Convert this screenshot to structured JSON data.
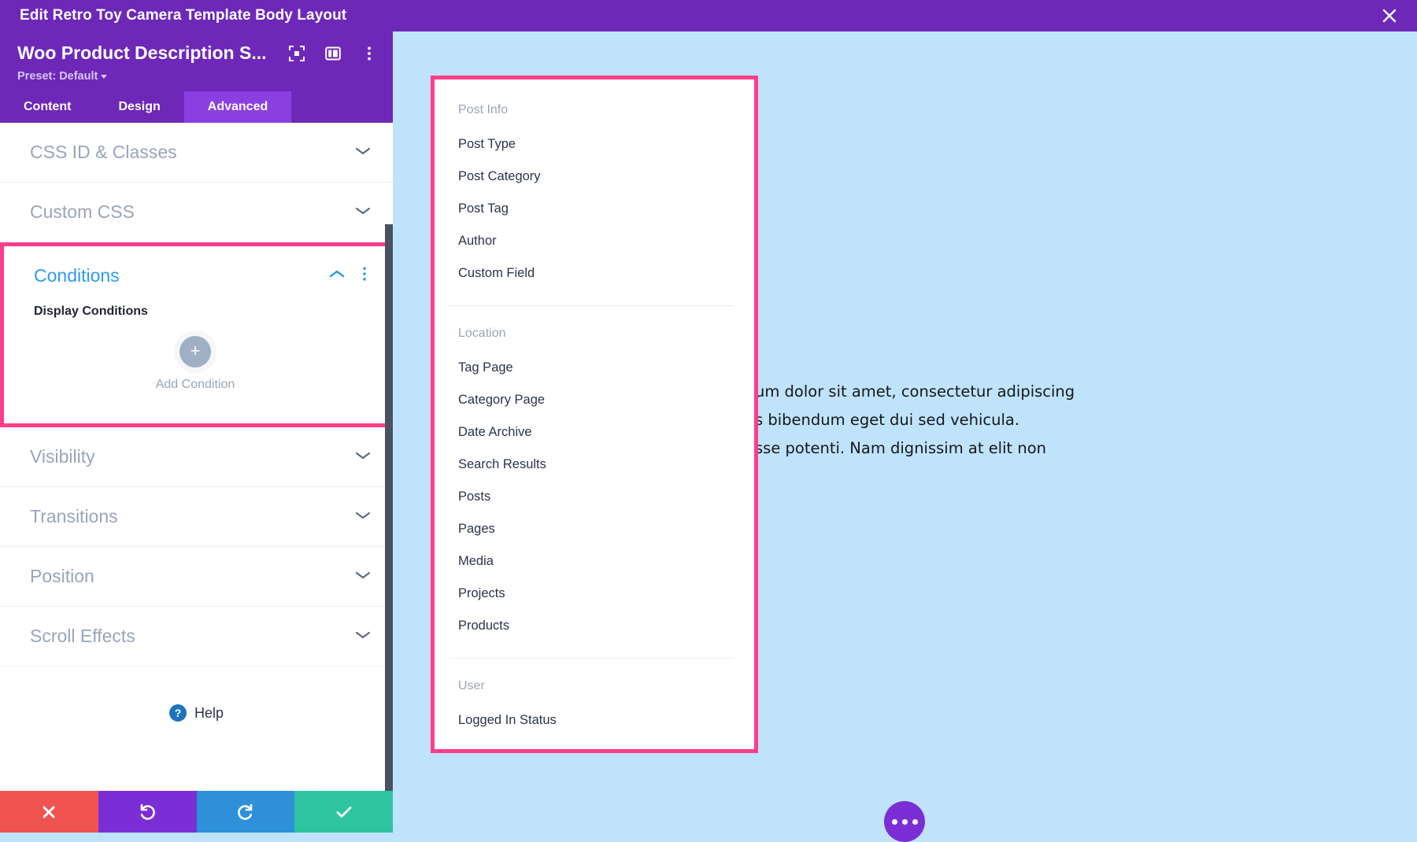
{
  "window": {
    "title": "Edit Retro Toy Camera Template Body Layout",
    "close_icon": "close-icon"
  },
  "panel": {
    "module_title": "Woo Product Description S...",
    "preset": "Preset: Default",
    "header_icons": [
      "focus-icon",
      "layout-panel-icon",
      "kebab-menu-icon"
    ],
    "tabs": [
      {
        "label": "Content",
        "active": false
      },
      {
        "label": "Design",
        "active": false
      },
      {
        "label": "Advanced",
        "active": true
      }
    ],
    "sections_above": [
      {
        "label": "CSS ID & Classes",
        "state": "collapsed"
      },
      {
        "label": "Custom CSS",
        "state": "collapsed"
      }
    ],
    "conditions": {
      "title": "Conditions",
      "state": "expanded",
      "highlighted": true,
      "field_label": "Display Conditions",
      "add_button_label": "Add Condition",
      "add_icon": "plus-icon",
      "collapse_icon": "chevron-up-icon",
      "options_icon": "kebab-menu-icon"
    },
    "sections_below": [
      {
        "label": "Visibility",
        "state": "collapsed"
      },
      {
        "label": "Transitions",
        "state": "collapsed"
      },
      {
        "label": "Position",
        "state": "collapsed"
      },
      {
        "label": "Scroll Effects",
        "state": "collapsed"
      }
    ],
    "help": {
      "label": "Help",
      "icon": "question-mark-icon"
    },
    "actions": [
      {
        "name": "cancel",
        "icon": "x-icon",
        "color": "#ef5350"
      },
      {
        "name": "undo",
        "icon": "undo-icon",
        "color": "#7b2ed6"
      },
      {
        "name": "redo",
        "icon": "redo-icon",
        "color": "#2e90d9"
      },
      {
        "name": "save",
        "icon": "check-icon",
        "color": "#2ec4a0"
      }
    ]
  },
  "dropdown": {
    "highlighted": true,
    "groups": [
      {
        "title": "Post Info",
        "items": [
          "Post Type",
          "Post Category",
          "Post Tag",
          "Author",
          "Custom Field"
        ]
      },
      {
        "title": "Location",
        "items": [
          "Tag Page",
          "Category Page",
          "Date Archive",
          "Search Results",
          "Posts",
          "Pages",
          "Media",
          "Projects",
          "Products"
        ]
      },
      {
        "title": "User",
        "items": [
          "Logged In Status"
        ]
      }
    ]
  },
  "content": {
    "body_text": "um dolor sit amet, consectetur adipiscing\ns bibendum eget dui sed vehicula.\nsse potenti. Nam dignissim at elit non",
    "fab_icon": "ellipsis-icon"
  },
  "colors": {
    "brand_purple": "#6d28b8",
    "active_tab": "#8b3fe0",
    "highlight_pink": "#ff3d8a",
    "accent_blue": "#2d9cec",
    "canvas_blue": "#bfe3fb"
  }
}
